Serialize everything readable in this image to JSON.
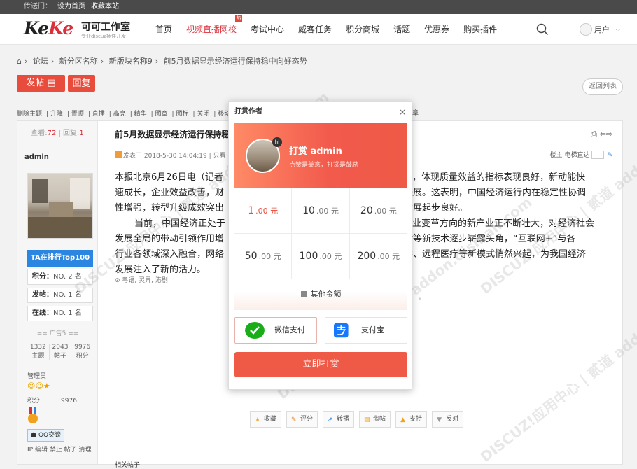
{
  "topbar": {
    "portal": "传送门：",
    "set_home": "设为首页",
    "bookmark": "收藏本站"
  },
  "logo": {
    "brand_a": "Ke",
    "brand_b": "Ke",
    "name": "可可工作室",
    "tagline": "专业discuz插件开发"
  },
  "nav": [
    {
      "label": "首页"
    },
    {
      "label": "视频直播网校",
      "active": true,
      "badge": "热"
    },
    {
      "label": "考试中心"
    },
    {
      "label": "威客任务"
    },
    {
      "label": "积分商城"
    },
    {
      "label": "话题"
    },
    {
      "label": "优惠券"
    },
    {
      "label": "购买插件"
    }
  ],
  "user": {
    "label": "用户"
  },
  "breadcrumb": [
    "论坛",
    "新分区名称",
    "新版块名称9",
    "前5月数据显示经济运行保持稳中向好态势"
  ],
  "buttons": {
    "post": "发帖",
    "reply": "回复",
    "back": "返回列表"
  },
  "mod_tools": [
    "删除主题",
    "升降",
    "置顶",
    "直播",
    "高亮",
    "精华",
    "图章",
    "图标",
    "关闭",
    "移动"
  ],
  "mod_tools_tail": "章",
  "sidebar": {
    "views_label": "查看:",
    "views": "72",
    "replies_label": "回复:",
    "replies": "1",
    "username": "admin",
    "rank_top": "TA在排行Top100",
    "rank_rows": [
      {
        "label": "积分：",
        "value": "NO. 2 名"
      },
      {
        "label": "发帖：",
        "value": "NO. 1 名"
      },
      {
        "label": "在线：",
        "value": "NO. 1 名"
      }
    ],
    "ad": "== 广告5 ==",
    "stats": [
      {
        "num": "1332",
        "label": "主题"
      },
      {
        "num": "2043",
        "label": "帖子"
      },
      {
        "num": "9976",
        "label": "积分"
      }
    ],
    "group": "管理员",
    "jifen_label": "积分",
    "jifen_value": "9976",
    "qq": "QQ交谈",
    "ops": "IP 编辑 禁止 帖子 清理"
  },
  "post": {
    "title": "前5月数据显示经济运行保持稳",
    "meta": "发表于 2018-5-30 14:04:19 | 只看",
    "floor_label": "楼主",
    "elevator": "电梯直达",
    "body": [
      "本报北京6月26日电（记者",
      "月，体现质量效益的指标表现良好，新动能快",
      "速成长，企业效益改善，财",
      "级进展。这表明，中国经济运行内在稳定性协调",
      "性增强，转型升级成效突出",
      "量发展起步良好。",
      "当前，中国经济正处于",
      "产业变革方向的新产业正不断壮大，对经济社会",
      "发展全局的带动引领作用增",
      "支付等新技术逐步崭露头角，“互联网+”与各",
      "行业各领域深入融合，网络",
      "教学、远程医疗等新模式悄然兴起，为我国经济",
      "发展注入了新的活力。"
    ],
    "tags": "粤语, 灵异, 港剧",
    "quote_tail": "\"",
    "actions": [
      "收藏",
      "评分",
      "转播",
      "淘帖",
      "支持",
      "反对"
    ],
    "related": "相关帖子"
  },
  "modal": {
    "title": "打赏作者",
    "close": "×",
    "badge": "hi",
    "heading": "打赏 admin",
    "slogan": "点赞是美意，打赏是鼓励",
    "amounts": [
      {
        "int": "1",
        "dec": ".00 元",
        "selected": true
      },
      {
        "int": "10",
        "dec": ".00 元"
      },
      {
        "int": "20",
        "dec": ".00 元"
      },
      {
        "int": "50",
        "dec": ".00 元"
      },
      {
        "int": "100",
        "dec": ".00 元"
      },
      {
        "int": "200",
        "dec": ".00 元"
      }
    ],
    "other": "其他金额",
    "wechat": "微信支付",
    "alipay": "支付宝",
    "submit": "立即打赏"
  },
  "watermark": "DISCUZ!应用中心 | 贰道 addon.dismall.com",
  "colors": {
    "accent": "#e74c3c",
    "rank_blue": "#2a86e0",
    "wechat": "#1aad19",
    "alipay": "#1677ff"
  }
}
